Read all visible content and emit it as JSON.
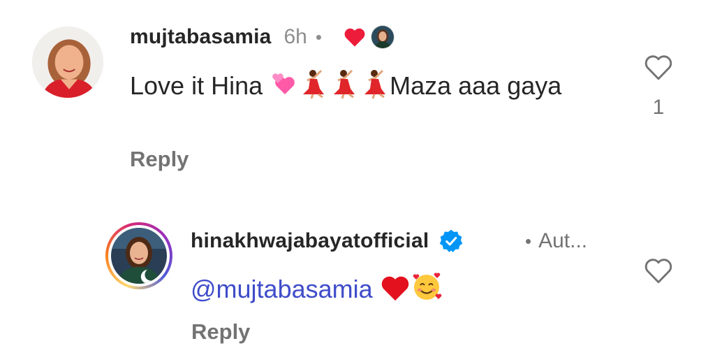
{
  "comments": [
    {
      "username": "mujtabasamia",
      "time": "6h",
      "separator": "•",
      "liked_by_author": true,
      "text_before": "Love it Hina ",
      "text_after": "Maza aaa gaya",
      "emojis_inline": [
        "two-hearts",
        "woman-dancing",
        "woman-dancing",
        "woman-dancing"
      ],
      "reply_label": "Reply",
      "like_count": "1"
    }
  ],
  "reply": {
    "username": "hinakhwajabayatofficial",
    "verified": true,
    "separator": "•",
    "author_tag": "Aut...",
    "mention": "@mujtabasamia",
    "emojis_inline": [
      "red-heart",
      "smiling-face-with-hearts"
    ],
    "reply_label": "Reply"
  },
  "colors": {
    "text": "#262626",
    "secondary": "#737373",
    "mention": "#3f4cc9",
    "heart_red": "#ed1c3a",
    "verified_blue": "#0095f6"
  },
  "icons": [
    "heart-outline-icon",
    "heart-filled-icon",
    "verified-badge-icon"
  ]
}
